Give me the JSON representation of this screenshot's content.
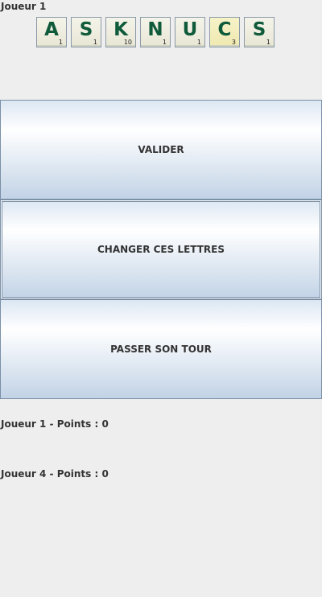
{
  "current_player": "Joueur 1",
  "rack": [
    {
      "letter": "A",
      "score": "1",
      "highlight": false
    },
    {
      "letter": "S",
      "score": "1",
      "highlight": false
    },
    {
      "letter": "K",
      "score": "10",
      "highlight": false
    },
    {
      "letter": "N",
      "score": "1",
      "highlight": false
    },
    {
      "letter": "U",
      "score": "1",
      "highlight": false
    },
    {
      "letter": "C",
      "score": "3",
      "highlight": true
    },
    {
      "letter": "S",
      "score": "1",
      "highlight": false
    }
  ],
  "actions": {
    "validate": "VALIDER",
    "change_letters": "CHANGER CES LETTRES",
    "pass_turn": "PASSER SON TOUR"
  },
  "scores": [
    "Joueur 1 - Points : 0",
    "Joueur 4 - Points : 0"
  ],
  "colors": {
    "background": "#eeeeee",
    "tile_letter": "#0e5a3a",
    "button_border": "#7a8fa6"
  }
}
